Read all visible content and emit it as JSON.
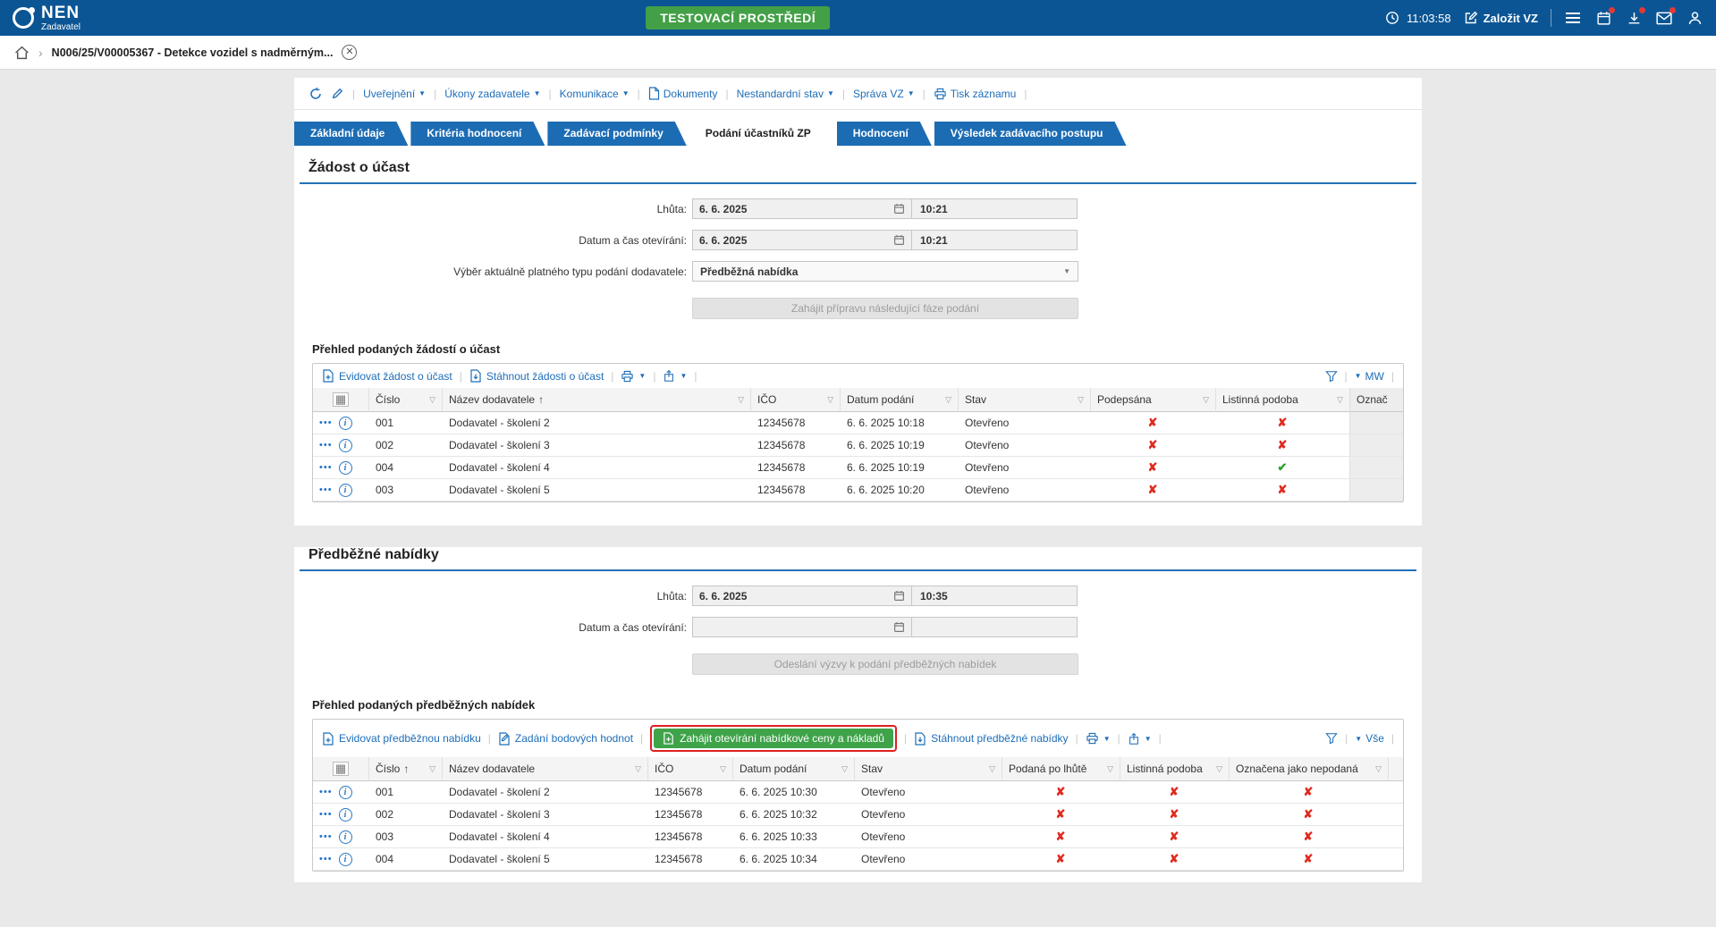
{
  "header": {
    "logo": "NEN",
    "logo_sub": "Zadavatel",
    "env_badge": "TESTOVACÍ PROSTŘEDÍ",
    "time": "11:03:58",
    "zalozit_vz": "Založit VZ"
  },
  "breadcrumb": {
    "item": "N006/25/V00005367 - Detekce vozidel s nadměrným..."
  },
  "cmdbar": {
    "uverejneni": "Uveřejnění",
    "ukony": "Úkony zadavatele",
    "komunikace": "Komunikace",
    "dokumenty": "Dokumenty",
    "nestandardni": "Nestandardní stav",
    "sprava": "Správa VZ",
    "tisk": "Tisk záznamu"
  },
  "tabs": {
    "zakladni": "Základní údaje",
    "kriteria": "Kritéria hodnocení",
    "zadavaci": "Zadávací podmínky",
    "podani": "Podání účastníků ZP",
    "hodnoceni": "Hodnocení",
    "vysledek": "Výsledek zadávacího postupu"
  },
  "zadost": {
    "title": "Žádost o účast",
    "labels": {
      "lhuta": "Lhůta:",
      "otevirani": "Datum a čas otevírání:",
      "vyber": "Výběr aktuálně platného typu podání dodavatele:"
    },
    "lhuta_date": "6. 6. 2025",
    "lhuta_time": "10:21",
    "otevirani_date": "6. 6. 2025",
    "otevirani_time": "10:21",
    "vyber_value": "Předběžná nabídka",
    "action_button": "Zahájit přípravu následující fáze podání",
    "table_title": "Přehled podaných žádostí o účast",
    "table": {
      "toolbar": {
        "evidovat": "Evidovat žádost o účast",
        "stahnout": "Stáhnout žádosti o účast",
        "view": "MW"
      },
      "columns": {
        "cislo": "Číslo",
        "nazev": "Název dodavatele",
        "ico": "IČO",
        "datum": "Datum podání",
        "stav": "Stav",
        "podepsana": "Podepsána",
        "listinna": "Listinná podoba",
        "oznacena": "Označ"
      },
      "rows": [
        {
          "cislo": "001",
          "nazev": "Dodavatel - školení 2",
          "ico": "12345678",
          "datum": "6. 6. 2025 10:18",
          "stav": "Otevřeno",
          "podepsana": "no",
          "listinna": "no"
        },
        {
          "cislo": "002",
          "nazev": "Dodavatel - školení 3",
          "ico": "12345678",
          "datum": "6. 6. 2025 10:19",
          "stav": "Otevřeno",
          "podepsana": "no",
          "listinna": "no"
        },
        {
          "cislo": "004",
          "nazev": "Dodavatel - školení 4",
          "ico": "12345678",
          "datum": "6. 6. 2025 10:19",
          "stav": "Otevřeno",
          "podepsana": "no",
          "listinna": "yes"
        },
        {
          "cislo": "003",
          "nazev": "Dodavatel - školení 5",
          "ico": "12345678",
          "datum": "6. 6. 2025 10:20",
          "stav": "Otevřeno",
          "podepsana": "no",
          "listinna": "no"
        }
      ]
    }
  },
  "nabidky": {
    "title": "Předběžné nabídky",
    "labels": {
      "lhuta": "Lhůta:",
      "otevirani": "Datum a čas otevírání:"
    },
    "lhuta_date": "6. 6. 2025",
    "lhuta_time": "10:35",
    "otevirani_date": "",
    "otevirani_time": "",
    "action_button": "Odeslání výzvy k podání předběžných nabídek",
    "table_title": "Přehled podaných předběžných nabídek",
    "table": {
      "toolbar": {
        "evidovat": "Evidovat předběžnou nabídku",
        "zadani": "Zadání bodových hodnot",
        "zahajit": "Zahájit otevírání nabídkové ceny a nákladů",
        "stahnout": "Stáhnout předběžné nabídky",
        "view": "Vše"
      },
      "columns": {
        "cislo": "Číslo",
        "nazev": "Název dodavatele",
        "ico": "IČO",
        "datum": "Datum podání",
        "stav": "Stav",
        "po_lhute": "Podaná po lhůtě",
        "listinna": "Listinná podoba",
        "nepodana": "Označena jako nepodaná"
      },
      "rows": [
        {
          "cislo": "001",
          "nazev": "Dodavatel - školení 2",
          "ico": "12345678",
          "datum": "6. 6. 2025 10:30",
          "stav": "Otevřeno",
          "po_lhute": "no",
          "listinna": "no",
          "nepodana": "no"
        },
        {
          "cislo": "002",
          "nazev": "Dodavatel - školení 3",
          "ico": "12345678",
          "datum": "6. 6. 2025 10:32",
          "stav": "Otevřeno",
          "po_lhute": "no",
          "listinna": "no",
          "nepodana": "no"
        },
        {
          "cislo": "003",
          "nazev": "Dodavatel - školení 4",
          "ico": "12345678",
          "datum": "6. 6. 2025 10:33",
          "stav": "Otevřeno",
          "po_lhute": "no",
          "listinna": "no",
          "nepodana": "no"
        },
        {
          "cislo": "004",
          "nazev": "Dodavatel - školení 5",
          "ico": "12345678",
          "datum": "6. 6. 2025 10:34",
          "stav": "Otevřeno",
          "po_lhute": "no",
          "listinna": "no",
          "nepodana": "no"
        }
      ]
    }
  },
  "colors": {
    "header_bg": "#0b5594",
    "tab_blue": "#1c6cb4",
    "link_blue": "#1d6db8",
    "env_green": "#43a047",
    "action_green": "#3fa34a",
    "mark_red": "#e02b20",
    "mark_green": "#2ea12e",
    "annotation_red": "#e01f1f"
  }
}
